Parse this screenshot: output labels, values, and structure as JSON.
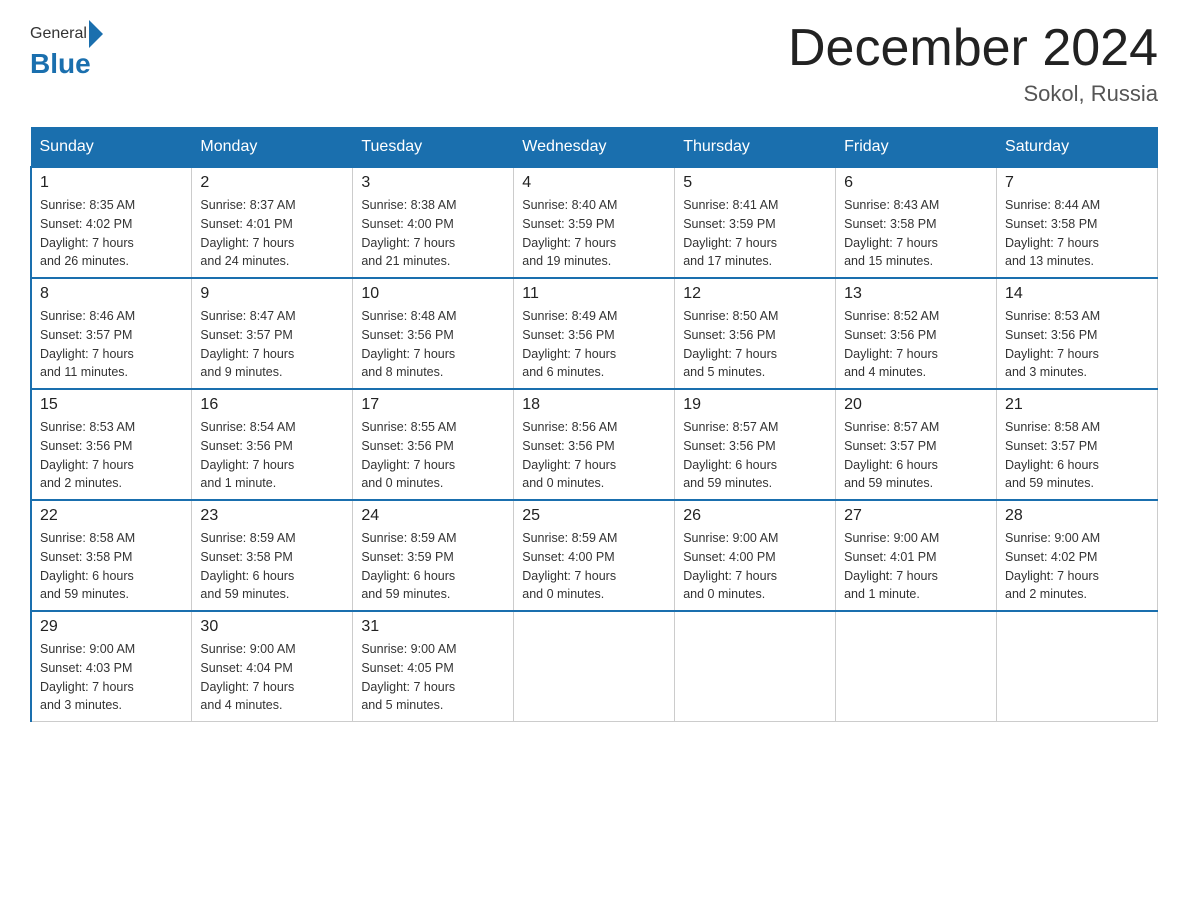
{
  "header": {
    "logo_general": "General",
    "logo_blue": "Blue",
    "month_title": "December 2024",
    "location": "Sokol, Russia"
  },
  "days_of_week": [
    "Sunday",
    "Monday",
    "Tuesday",
    "Wednesday",
    "Thursday",
    "Friday",
    "Saturday"
  ],
  "weeks": [
    [
      {
        "day": "1",
        "sunrise": "8:35 AM",
        "sunset": "4:02 PM",
        "daylight": "7 hours and 26 minutes."
      },
      {
        "day": "2",
        "sunrise": "8:37 AM",
        "sunset": "4:01 PM",
        "daylight": "7 hours and 24 minutes."
      },
      {
        "day": "3",
        "sunrise": "8:38 AM",
        "sunset": "4:00 PM",
        "daylight": "7 hours and 21 minutes."
      },
      {
        "day": "4",
        "sunrise": "8:40 AM",
        "sunset": "3:59 PM",
        "daylight": "7 hours and 19 minutes."
      },
      {
        "day": "5",
        "sunrise": "8:41 AM",
        "sunset": "3:59 PM",
        "daylight": "7 hours and 17 minutes."
      },
      {
        "day": "6",
        "sunrise": "8:43 AM",
        "sunset": "3:58 PM",
        "daylight": "7 hours and 15 minutes."
      },
      {
        "day": "7",
        "sunrise": "8:44 AM",
        "sunset": "3:58 PM",
        "daylight": "7 hours and 13 minutes."
      }
    ],
    [
      {
        "day": "8",
        "sunrise": "8:46 AM",
        "sunset": "3:57 PM",
        "daylight": "7 hours and 11 minutes."
      },
      {
        "day": "9",
        "sunrise": "8:47 AM",
        "sunset": "3:57 PM",
        "daylight": "7 hours and 9 minutes."
      },
      {
        "day": "10",
        "sunrise": "8:48 AM",
        "sunset": "3:56 PM",
        "daylight": "7 hours and 8 minutes."
      },
      {
        "day": "11",
        "sunrise": "8:49 AM",
        "sunset": "3:56 PM",
        "daylight": "7 hours and 6 minutes."
      },
      {
        "day": "12",
        "sunrise": "8:50 AM",
        "sunset": "3:56 PM",
        "daylight": "7 hours and 5 minutes."
      },
      {
        "day": "13",
        "sunrise": "8:52 AM",
        "sunset": "3:56 PM",
        "daylight": "7 hours and 4 minutes."
      },
      {
        "day": "14",
        "sunrise": "8:53 AM",
        "sunset": "3:56 PM",
        "daylight": "7 hours and 3 minutes."
      }
    ],
    [
      {
        "day": "15",
        "sunrise": "8:53 AM",
        "sunset": "3:56 PM",
        "daylight": "7 hours and 2 minutes."
      },
      {
        "day": "16",
        "sunrise": "8:54 AM",
        "sunset": "3:56 PM",
        "daylight": "7 hours and 1 minute."
      },
      {
        "day": "17",
        "sunrise": "8:55 AM",
        "sunset": "3:56 PM",
        "daylight": "7 hours and 0 minutes."
      },
      {
        "day": "18",
        "sunrise": "8:56 AM",
        "sunset": "3:56 PM",
        "daylight": "7 hours and 0 minutes."
      },
      {
        "day": "19",
        "sunrise": "8:57 AM",
        "sunset": "3:56 PM",
        "daylight": "6 hours and 59 minutes."
      },
      {
        "day": "20",
        "sunrise": "8:57 AM",
        "sunset": "3:57 PM",
        "daylight": "6 hours and 59 minutes."
      },
      {
        "day": "21",
        "sunrise": "8:58 AM",
        "sunset": "3:57 PM",
        "daylight": "6 hours and 59 minutes."
      }
    ],
    [
      {
        "day": "22",
        "sunrise": "8:58 AM",
        "sunset": "3:58 PM",
        "daylight": "6 hours and 59 minutes."
      },
      {
        "day": "23",
        "sunrise": "8:59 AM",
        "sunset": "3:58 PM",
        "daylight": "6 hours and 59 minutes."
      },
      {
        "day": "24",
        "sunrise": "8:59 AM",
        "sunset": "3:59 PM",
        "daylight": "6 hours and 59 minutes."
      },
      {
        "day": "25",
        "sunrise": "8:59 AM",
        "sunset": "4:00 PM",
        "daylight": "7 hours and 0 minutes."
      },
      {
        "day": "26",
        "sunrise": "9:00 AM",
        "sunset": "4:00 PM",
        "daylight": "7 hours and 0 minutes."
      },
      {
        "day": "27",
        "sunrise": "9:00 AM",
        "sunset": "4:01 PM",
        "daylight": "7 hours and 1 minute."
      },
      {
        "day": "28",
        "sunrise": "9:00 AM",
        "sunset": "4:02 PM",
        "daylight": "7 hours and 2 minutes."
      }
    ],
    [
      {
        "day": "29",
        "sunrise": "9:00 AM",
        "sunset": "4:03 PM",
        "daylight": "7 hours and 3 minutes."
      },
      {
        "day": "30",
        "sunrise": "9:00 AM",
        "sunset": "4:04 PM",
        "daylight": "7 hours and 4 minutes."
      },
      {
        "day": "31",
        "sunrise": "9:00 AM",
        "sunset": "4:05 PM",
        "daylight": "7 hours and 5 minutes."
      },
      null,
      null,
      null,
      null
    ]
  ],
  "labels": {
    "sunrise": "Sunrise:",
    "sunset": "Sunset:",
    "daylight": "Daylight:"
  }
}
